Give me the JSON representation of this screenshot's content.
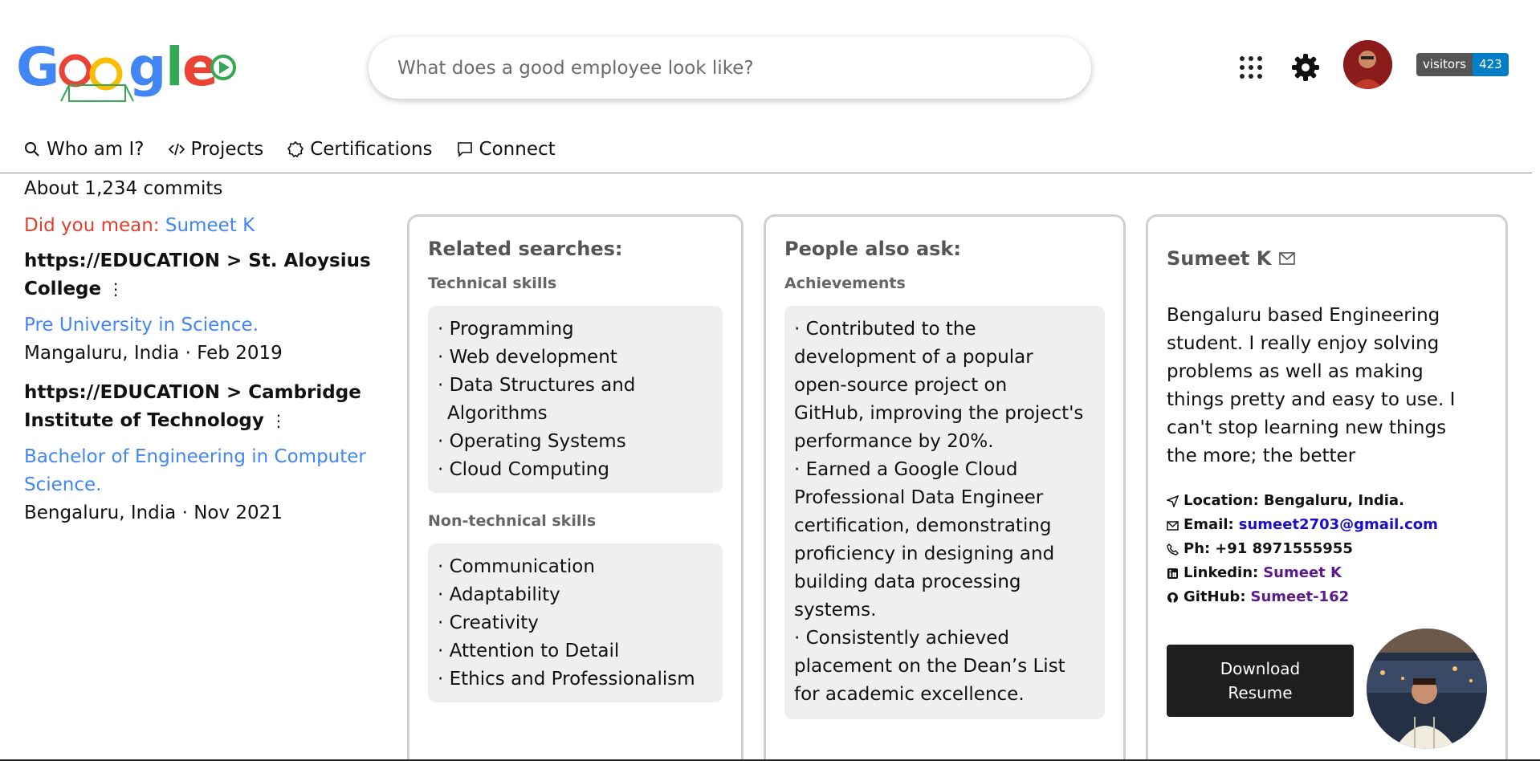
{
  "search": {
    "placeholder": "What does a good employee look like?"
  },
  "header": {
    "visitors_label": "visitors",
    "visitors_count": "423"
  },
  "nav": {
    "items": [
      {
        "label": "Who am I?",
        "icon": "search-icon"
      },
      {
        "label": "Projects",
        "icon": "code-icon"
      },
      {
        "label": "Certifications",
        "icon": "badge-icon"
      },
      {
        "label": "Connect",
        "icon": "chat-icon"
      }
    ]
  },
  "results": {
    "commits": "About 1,234 commits",
    "did_you_mean_prefix": "Did you mean: ",
    "did_you_mean_link": "Sumeet K",
    "education": [
      {
        "heading": "https://EDUCATION > St. Aloysius College",
        "degree": "Pre University in Science.",
        "meta": "Mangaluru, India · Feb 2019"
      },
      {
        "heading": "https://EDUCATION > Cambridge Institute of Technology",
        "degree": "Bachelor of Engineering in Computer Science.",
        "meta": "Bengaluru, India · Nov 2021"
      }
    ]
  },
  "related": {
    "title": "Related searches:",
    "technical_title": "Technical skills",
    "technical": [
      "· Programming",
      "· Web development",
      "· Data Structures and",
      "Algorithms",
      "· Operating Systems",
      "· Cloud Computing"
    ],
    "nontechnical_title": "Non-technical skills",
    "nontechnical": [
      "· Communication",
      "· Adaptability",
      "· Creativity",
      "· Attention to Detail",
      "· Ethics and Professionalism"
    ]
  },
  "people": {
    "title": "People also ask:",
    "sub": "Achievements",
    "lines": [
      "· Contributed to the",
      "development of a popular",
      "open-source project on",
      "GitHub, improving the project's",
      "performance by 20%.",
      "· Earned a Google Cloud",
      "Professional Data Engineer",
      "certification, demonstrating",
      "proficiency in designing and",
      "building data processing",
      "systems.",
      "· Consistently achieved",
      "placement on the Dean’s List",
      "for academic excellence."
    ]
  },
  "profile": {
    "name": "Sumeet K",
    "bio_lines": [
      "Bengaluru based Engineering",
      "student. I really enjoy solving",
      "problems as well as making",
      "things pretty and easy to use. I",
      "can't stop learning new things",
      "the more; the better"
    ],
    "location_label": "Location:",
    "location_value": "Bengaluru, India.",
    "email_label": "Email:",
    "email_value": "sumeet2703@gmail.com",
    "phone_label": "Ph:",
    "phone_value": "+91 8971555955",
    "linkedin_label": "Linkedin:",
    "linkedin_value": "Sumeet K",
    "github_label": "GitHub:",
    "github_value": "Sumeet-162",
    "download_line1": "Download",
    "download_line2": "Resume"
  },
  "colors": {
    "link_blue": "#4285f4",
    "did_you_mean_red": "#e0412f",
    "email_blue": "#1a0dcc",
    "visited_purple": "#5a1a8c"
  }
}
